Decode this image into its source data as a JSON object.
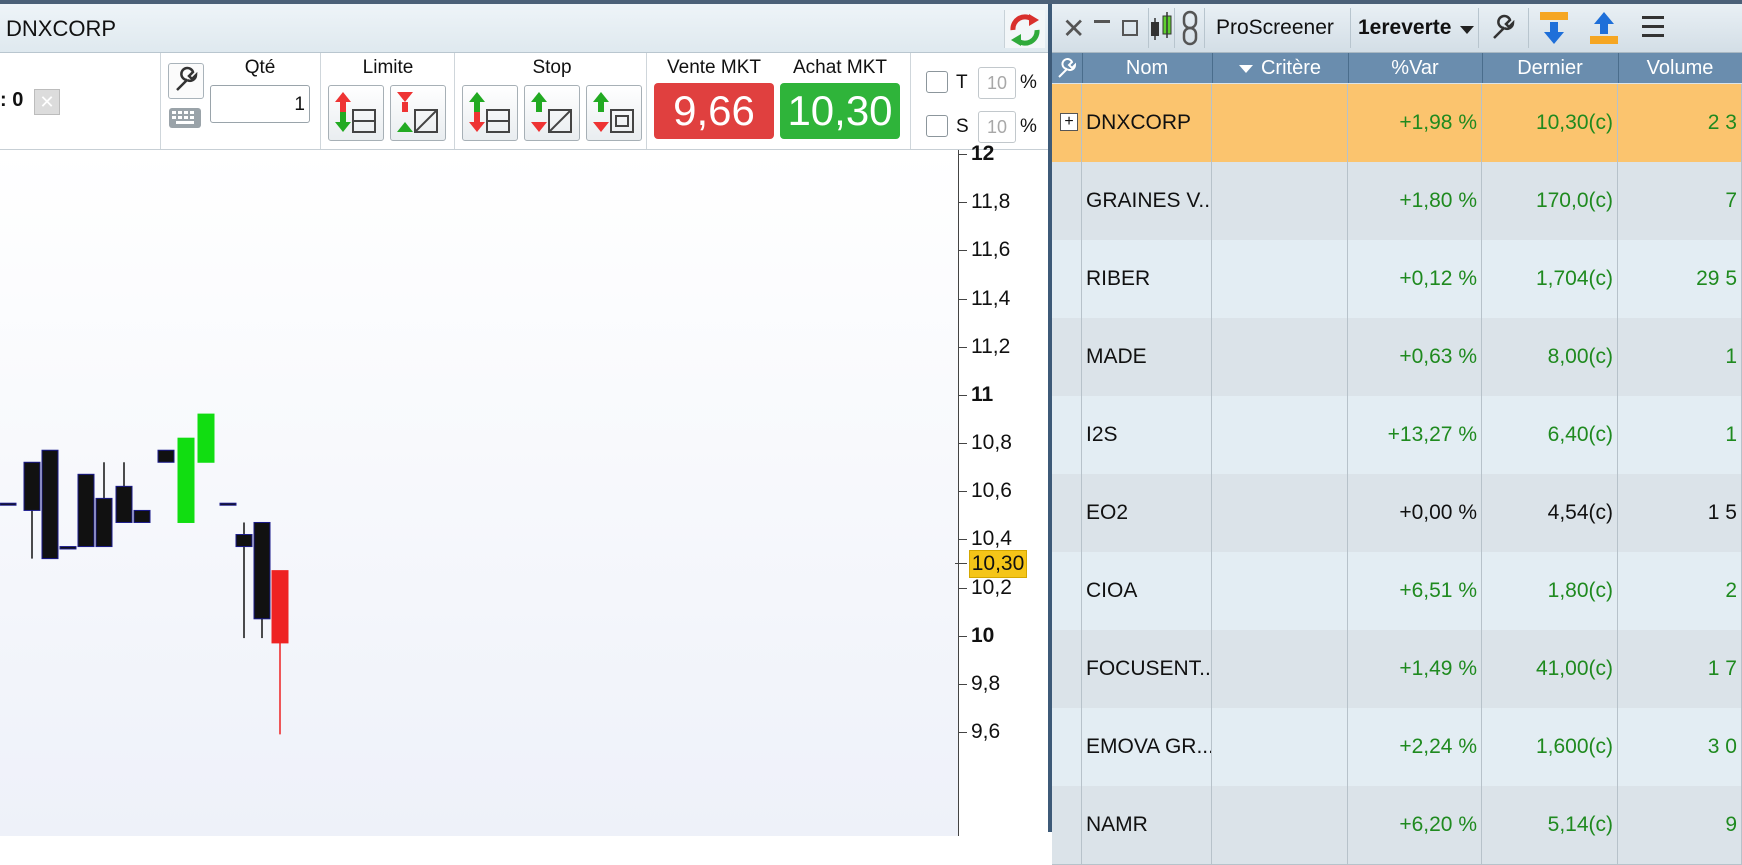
{
  "chart_window": {
    "title": "DNXCORP",
    "position_value": ": 0",
    "qty_label": "Qté",
    "qty_value": "1",
    "limit_label": "Limite",
    "stop_label": "Stop",
    "sell_label": "Vente MKT",
    "sell_price": "9,66",
    "buy_label": "Achat MKT",
    "buy_price": "10,30",
    "t_label": "T",
    "s_label": "S",
    "t_value": "10",
    "s_value": "10",
    "pct": "%",
    "last_price_tag": "10,30",
    "colors": {
      "sell": "#e0403f",
      "buy": "#2fb43a",
      "price_tag": "#f5c518"
    }
  },
  "chart_data": {
    "type": "candlestick",
    "y_ticks": [
      "12",
      "11,8",
      "11,6",
      "11,4",
      "11,2",
      "11",
      "10,8",
      "10,6",
      "10,4",
      "10,2",
      "10",
      "9,8",
      "9,6"
    ],
    "ylim": [
      9.6,
      12.0
    ],
    "last_price": 10.3,
    "candles": [
      {
        "open": 10.55,
        "high": 10.55,
        "low": 10.55,
        "close": 10.55,
        "color": "black"
      },
      {
        "open": 10.72,
        "high": 10.72,
        "low": 10.32,
        "close": 10.52,
        "color": "black"
      },
      {
        "open": 10.77,
        "high": 10.77,
        "low": 10.32,
        "close": 10.32,
        "color": "black"
      },
      {
        "open": 10.37,
        "high": 10.37,
        "low": 10.36,
        "close": 10.36,
        "color": "black"
      },
      {
        "open": 10.67,
        "high": 10.67,
        "low": 10.37,
        "close": 10.37,
        "color": "black"
      },
      {
        "open": 10.57,
        "high": 10.72,
        "low": 10.37,
        "close": 10.37,
        "color": "black"
      },
      {
        "open": 10.62,
        "high": 10.72,
        "low": 10.47,
        "close": 10.47,
        "color": "black"
      },
      {
        "open": 10.52,
        "high": 10.52,
        "low": 10.47,
        "close": 10.47,
        "color": "black"
      },
      {
        "open": 10.77,
        "high": 10.77,
        "low": 10.72,
        "close": 10.72,
        "color": "black"
      },
      {
        "open": 10.47,
        "high": 10.82,
        "low": 10.47,
        "close": 10.82,
        "color": "green"
      },
      {
        "open": 10.72,
        "high": 10.92,
        "low": 10.72,
        "close": 10.92,
        "color": "green"
      },
      {
        "open": 10.55,
        "high": 10.55,
        "low": 10.55,
        "close": 10.55,
        "color": "black"
      },
      {
        "open": 10.42,
        "high": 10.47,
        "low": 9.99,
        "close": 10.37,
        "color": "black"
      },
      {
        "open": 10.47,
        "high": 10.47,
        "low": 9.99,
        "close": 10.07,
        "color": "black"
      },
      {
        "open": 10.27,
        "high": 10.27,
        "low": 9.59,
        "close": 9.97,
        "color": "red"
      }
    ]
  },
  "screener": {
    "proscreener": "ProScreener",
    "list_name": "1ereverte",
    "columns": [
      "Nom",
      "Critère",
      "%Var",
      "Dernier",
      "Volume"
    ],
    "rows": [
      {
        "name": "DNXCORP",
        "critere": "",
        "var": "+1,98 %",
        "last": "10,30(c)",
        "volume": "2 3",
        "highlight": true
      },
      {
        "name": "GRAINES V...",
        "critere": "",
        "var": "+1,80 %",
        "last": "170,0(c)",
        "volume": "7"
      },
      {
        "name": "RIBER",
        "critere": "",
        "var": "+0,12 %",
        "last": "1,704(c)",
        "volume": "29 5"
      },
      {
        "name": "MADE",
        "critere": "",
        "var": "+0,63 %",
        "last": "8,00(c)",
        "volume": "1"
      },
      {
        "name": "I2S",
        "critere": "",
        "var": "+13,27 %",
        "last": "6,40(c)",
        "volume": "1"
      },
      {
        "name": "EO2",
        "critere": "",
        "var": "+0,00 %",
        "last": "4,54(c)",
        "volume": "1 5",
        "neutral": true
      },
      {
        "name": "CIOA",
        "critere": "",
        "var": "+6,51 %",
        "last": "1,80(c)",
        "volume": "2"
      },
      {
        "name": "FOCUSENT...",
        "critere": "",
        "var": "+1,49 %",
        "last": "41,00(c)",
        "volume": "1 7"
      },
      {
        "name": "EMOVA GR...",
        "critere": "",
        "var": "+2,24 %",
        "last": "1,600(c)",
        "volume": "3 0"
      },
      {
        "name": "NAMR",
        "critere": "",
        "var": "+6,20 %",
        "last": "5,14(c)",
        "volume": "9"
      }
    ],
    "colors": {
      "header": "#6a8dae",
      "highlight": "#fbc46e",
      "row_a": "#dbe3e9",
      "row_b": "#e3edf3",
      "positive": "#1f8a1f"
    }
  }
}
